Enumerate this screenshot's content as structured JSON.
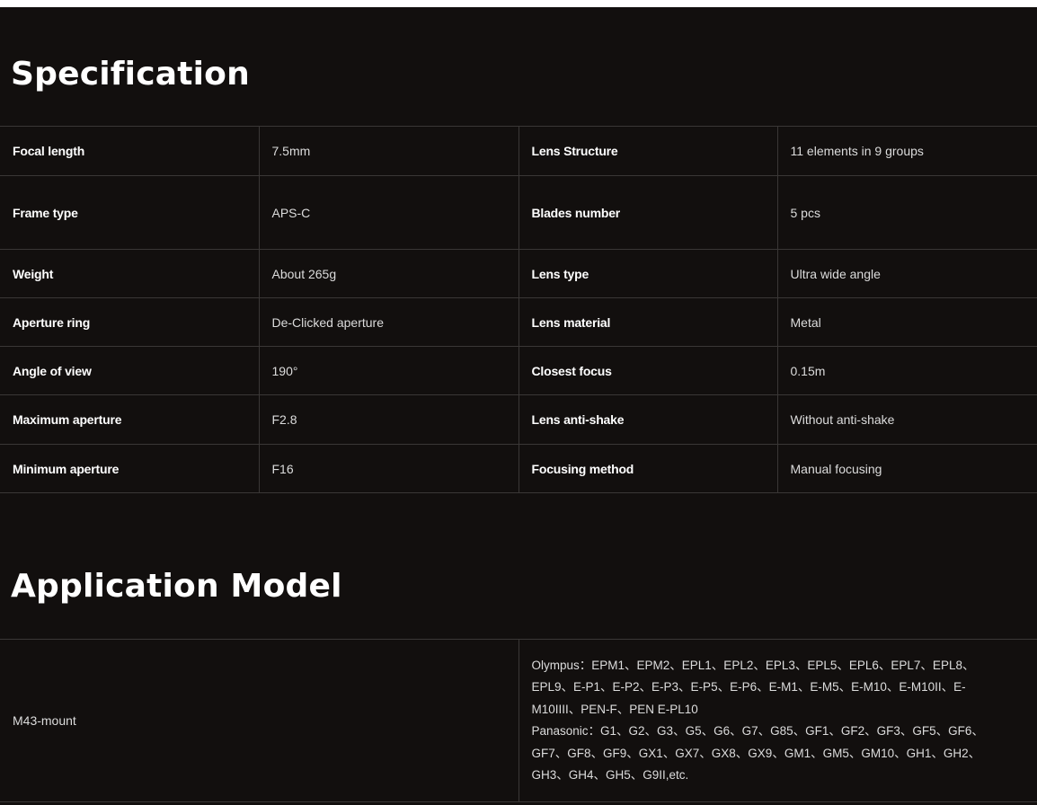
{
  "specification": {
    "title": "Specification",
    "rows": [
      {
        "label1": "Focal length",
        "value1": "7.5mm",
        "label2": "Lens Structure",
        "value2": "11 elements in 9 groups"
      },
      {
        "label1": "Frame type",
        "value1": "APS-C",
        "label2": "Blades number",
        "value2": "5 pcs"
      },
      {
        "label1": "Weight",
        "value1": "About 265g",
        "label2": "Lens type",
        "value2": "Ultra wide angle"
      },
      {
        "label1": "Aperture ring",
        "value1": "De-Clicked aperture",
        "label2": "Lens material",
        "value2": "Metal"
      },
      {
        "label1": "Angle of view",
        "value1": "190°",
        "label2": "Closest focus",
        "value2": "0.15m"
      },
      {
        "label1": "Maximum aperture",
        "value1": "F2.8",
        "label2": "Lens anti-shake",
        "value2": "Without anti-shake"
      },
      {
        "label1": "Minimum aperture",
        "value1": "F16",
        "label2": "Focusing method",
        "value2": "Manual focusing"
      }
    ]
  },
  "application": {
    "title": "Application Model",
    "mount": "M43-mount",
    "lines": [
      "Olympus：EPM1、EPM2、EPL1、EPL2、EPL3、EPL5、EPL6、EPL7、EPL8、",
      "EPL9、E-P1、E-P2、E-P3、E-P5、E-P6、E-M1、E-M5、E-M10、E-M10II、E-",
      "M10IIII、PEN-F、PEN E-PL10",
      "Panasonic：G1、G2、G3、G5、G6、G7、G85、GF1、GF2、GF3、GF5、GF6、",
      "GF7、GF8、GF9、GX1、GX7、GX8、GX9、GM1、GM5、GM10、GH1、GH2、",
      "GH3、GH4、GH5、G9II,etc."
    ]
  },
  "colors": {
    "background": "#120f0e",
    "border": "#3a3736",
    "text": "#e6e6e6"
  }
}
